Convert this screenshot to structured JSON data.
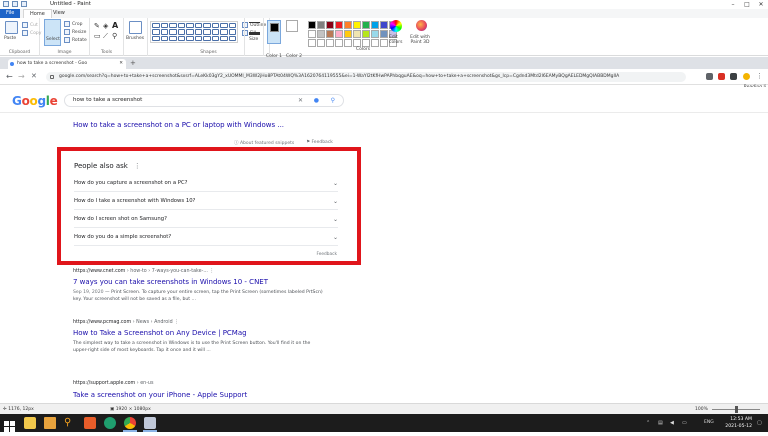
{
  "paint": {
    "title": "Untitled - Paint",
    "tabs": [
      "File",
      "Home",
      "View"
    ],
    "clipboard": {
      "paste": "Paste",
      "cut": "Cut",
      "copy": "Copy",
      "label": "Clipboard"
    },
    "image": {
      "select": "Select",
      "crop": "Crop",
      "resize": "Resize",
      "rotate": "Rotate",
      "label": "Image"
    },
    "tools_label": "Tools",
    "brushes": "Brushes",
    "shapes": {
      "outline": "Outline",
      "fill": "Fill",
      "label": "Shapes"
    },
    "size": "Size",
    "color1": "Color 1",
    "color2": "Color 2",
    "colors_label": "Colors",
    "edit_colors": "Edit colors",
    "edit_paint3d": "Edit with Paint 3D",
    "palette_row1": [
      "#000000",
      "#7f7f7f",
      "#880015",
      "#ed1c24",
      "#ff7f27",
      "#fff200",
      "#22b14c",
      "#00a2e8",
      "#3f48cc",
      "#a349a4"
    ],
    "palette_row2": [
      "#ffffff",
      "#c3c3c3",
      "#b97a57",
      "#ffaec9",
      "#ffc90e",
      "#efe4b0",
      "#b5e61d",
      "#99d9ea",
      "#7092be",
      "#c8bfe7"
    ],
    "palette_row3": [
      "#ffffff",
      "#ffffff",
      "#ffffff",
      "#ffffff",
      "#ffffff",
      "#ffffff",
      "#ffffff",
      "#ffffff",
      "#ffffff",
      "#ffffff"
    ]
  },
  "browser": {
    "tab_title": "how to take a screenshot - Goo",
    "url": "google.com/search?q=how+to+take+a+screenshot&sxsrf=ALeKk03gY2_xUOMMI_M3W2jHo8PTAt04WQ%3A1620764119555&ei=1-WaYI2tKfHwPAPhbqguAE&oq=how+to+take+a+screenshot&gs_lcp=Cgdnd3Mtd2l6EAMyBQgAELEDMgQIABBDMgIIA",
    "reading_list": "Reading li"
  },
  "google": {
    "search_query": "how to take a screenshot",
    "top_result_title": "How to take a screenshot on a PC or laptop with Windows ...",
    "about_featured": "About featured snippets",
    "feedback_top": "Feedback",
    "paa_title": "People also ask",
    "paa_questions": [
      "How do you capture a screenshot on a PC?",
      "How do I take a screenshot with Windows 10?",
      "How do I screen shot on Samsung?",
      "How do you do a simple screenshot?"
    ],
    "paa_feedback": "Feedback",
    "results": [
      {
        "url": "https://www.cnet.com",
        "crumb": " › how-to › 7-ways-you-can-take-...",
        "title": "7 ways you can take screenshots in Windows 10 - CNET",
        "date": "Sep 19, 2020",
        "snippet": " — Print Screen. To capture your entire screen, tap the Print Screen (sometimes labeled PrtScn) key. Your screenshot will not be saved as a file, but ..."
      },
      {
        "url": "https://www.pcmag.com",
        "crumb": " › News › Android",
        "title": "How to Take a Screenshot on Any Device | PCMag",
        "date": "",
        "snippet": "The simplest way to take a screenshot in Windows is to use the Print Screen button. You'll find it on the upper-right side of most keyboards. Tap it once and it will ..."
      },
      {
        "url": "https://support.apple.com",
        "crumb": " › en-us",
        "title": "Take a screenshot on your iPhone - Apple Support",
        "date": "",
        "snippet": ""
      }
    ]
  },
  "status": {
    "coords": "1176, 12px",
    "dimensions": "1920 × 1080px",
    "zoom": "100%"
  },
  "taskbar": {
    "lang": "ENG",
    "time": "12:53 AM",
    "date": "2021-05-12"
  }
}
